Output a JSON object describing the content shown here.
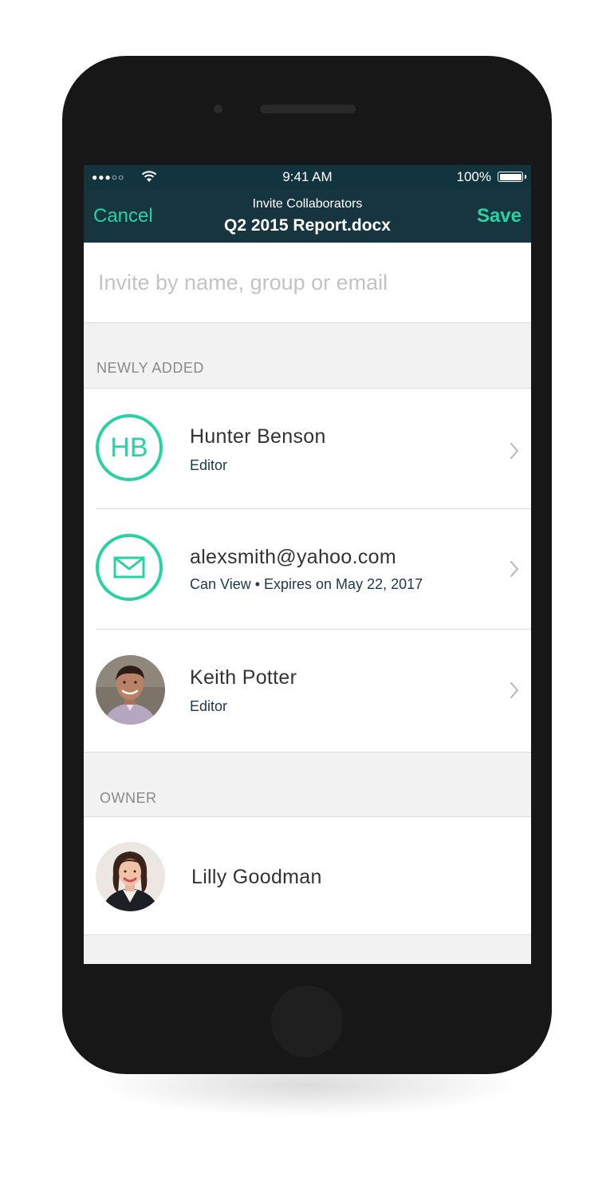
{
  "status_bar": {
    "signal": "●●●○○",
    "time": "9:41 AM",
    "battery_percent": "100%",
    "battery_level": 1.0
  },
  "nav": {
    "cancel_label": "Cancel",
    "subtitle": "Invite Collaborators",
    "title": "Q2 2015 Report.docx",
    "save_label": "Save"
  },
  "search": {
    "placeholder": "Invite by name, group or email",
    "value": ""
  },
  "sections": {
    "newly_added": {
      "header": "NEWLY ADDED",
      "items": [
        {
          "initials": "HB",
          "name": "Hunter Benson",
          "detail": "Editor",
          "avatar": "initials"
        },
        {
          "name": "alexsmith@yahoo.com",
          "detail": "Can View • Expires on May 22, 2017",
          "avatar": "envelope-icon"
        },
        {
          "name": "Keith Potter",
          "detail": "Editor",
          "avatar": "photo"
        }
      ]
    },
    "owner": {
      "header": "OWNER",
      "items": [
        {
          "name": "Lilly Goodman",
          "avatar": "photo"
        }
      ]
    }
  },
  "colors": {
    "accent": "#27d3a3",
    "navbar": "#17353f",
    "statusbar": "#11343f",
    "phone_body": "#171717",
    "section_bg": "#f2f2f2"
  }
}
